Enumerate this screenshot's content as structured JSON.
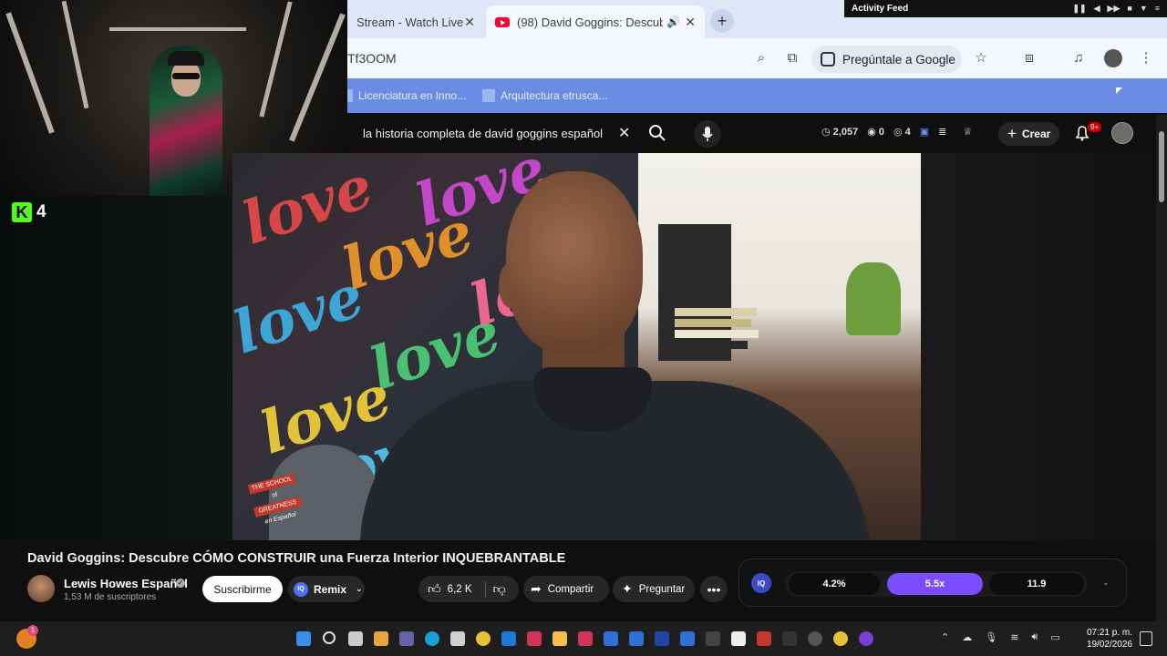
{
  "browser": {
    "tabs": [
      {
        "label": "Stream - Watch Live",
        "active": false
      },
      {
        "label": "(98) David Goggins: Descub",
        "active": true
      }
    ],
    "new_tab_icon": "plus-icon",
    "url": "Tf3OOM",
    "ask_google": "Pregúntale a Google",
    "bookmarks": [
      "Licenciatura en Inno...",
      "Arquitectura etrusca..."
    ]
  },
  "activity_feed": {
    "title": "Activity Feed"
  },
  "youtube": {
    "search_query": "la historia completa de david goggins español",
    "stats": {
      "views": "2,057",
      "eye": "0",
      "eye2": "4"
    },
    "create_label": "Crear",
    "bell_badge": "9+",
    "video": {
      "title": "David Goggins: Descubre CÓMO CONSTRUIR una Fuerza Interior INQUEBRANTABLE",
      "watermark": [
        "THE SCHOOL",
        "of",
        "GREATNESS",
        "en Español"
      ],
      "graffiti_word": "love"
    },
    "channel": {
      "name": "Lewis Howes Español",
      "subscribers": "1,53 M de suscriptores"
    },
    "actions": {
      "subscribe": "Suscribirme",
      "remix": "Remix",
      "likes": "6,2 K",
      "share": "Compartir",
      "ask": "Preguntar"
    },
    "iq_panel": {
      "logo": "IQ",
      "metrics": [
        "4.2%",
        "5.5x",
        "11.9"
      ]
    }
  },
  "stream_overlay": {
    "viewer_count": "4",
    "platform_logo": "K"
  },
  "taskbar": {
    "time": "07:21 p. m.",
    "date": "19/02/2026",
    "notification_badge": "1"
  },
  "colors": {
    "accent_purple": "#7c4dff",
    "bookmarks_bar": "#6a8ce3",
    "kick_green": "#53fc18",
    "youtube_red": "#ff0033"
  }
}
